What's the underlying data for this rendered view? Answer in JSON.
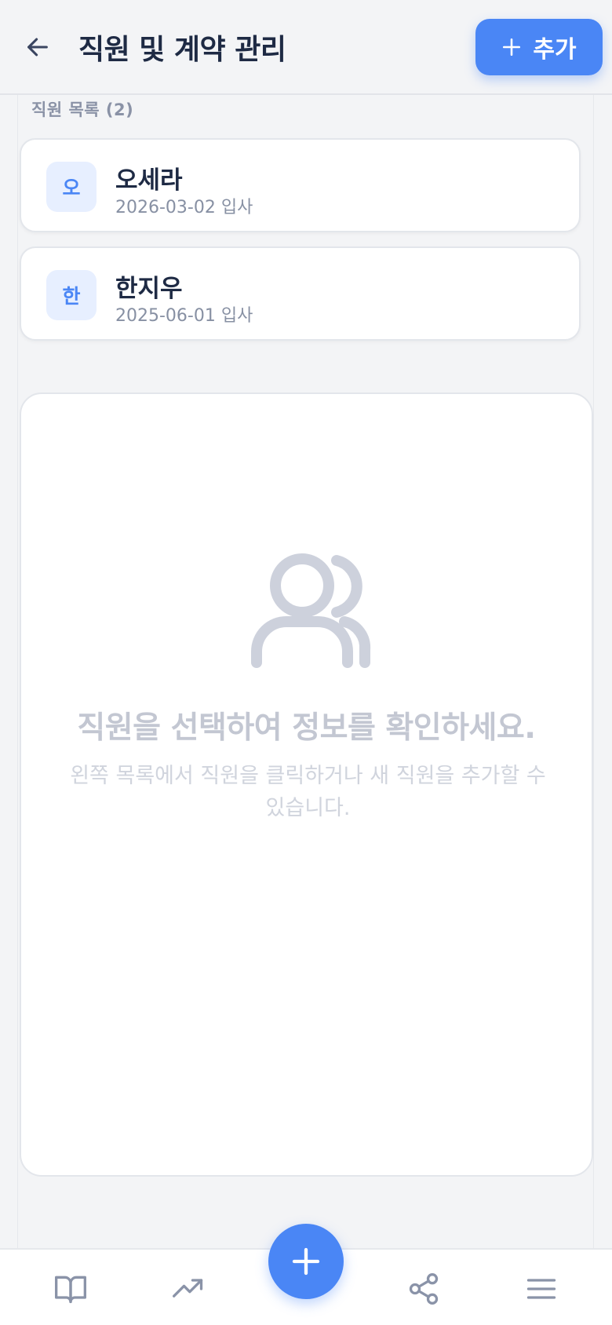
{
  "header": {
    "title": "직원 및 계약 관리",
    "back_icon": "arrow-left-icon",
    "add_label": "추가",
    "add_icon": "plus-icon"
  },
  "employee_list": {
    "heading": "직원 목록 (2)",
    "items": [
      {
        "avatar_initial": "오",
        "name": "오세라",
        "join_date": "2026-03-02 입사"
      },
      {
        "avatar_initial": "한",
        "name": "한지우",
        "join_date": "2025-06-01 입사"
      }
    ]
  },
  "detail_panel": {
    "empty_icon": "users-icon",
    "empty_title": "직원을 선택하여 정보를 확인하세요.",
    "empty_subtitle": "왼쪽 목록에서 직원을 클릭하거나 새 직원을 추가할 수 있습니다."
  },
  "bottom_nav": {
    "items": [
      "book-open-icon",
      "trending-up-icon",
      "plus-icon",
      "share-icon",
      "menu-icon"
    ]
  },
  "colors": {
    "accent": "#4a86f5",
    "background": "#f3f4f6",
    "text_primary": "#1e2a44",
    "text_muted": "#8790a3"
  }
}
